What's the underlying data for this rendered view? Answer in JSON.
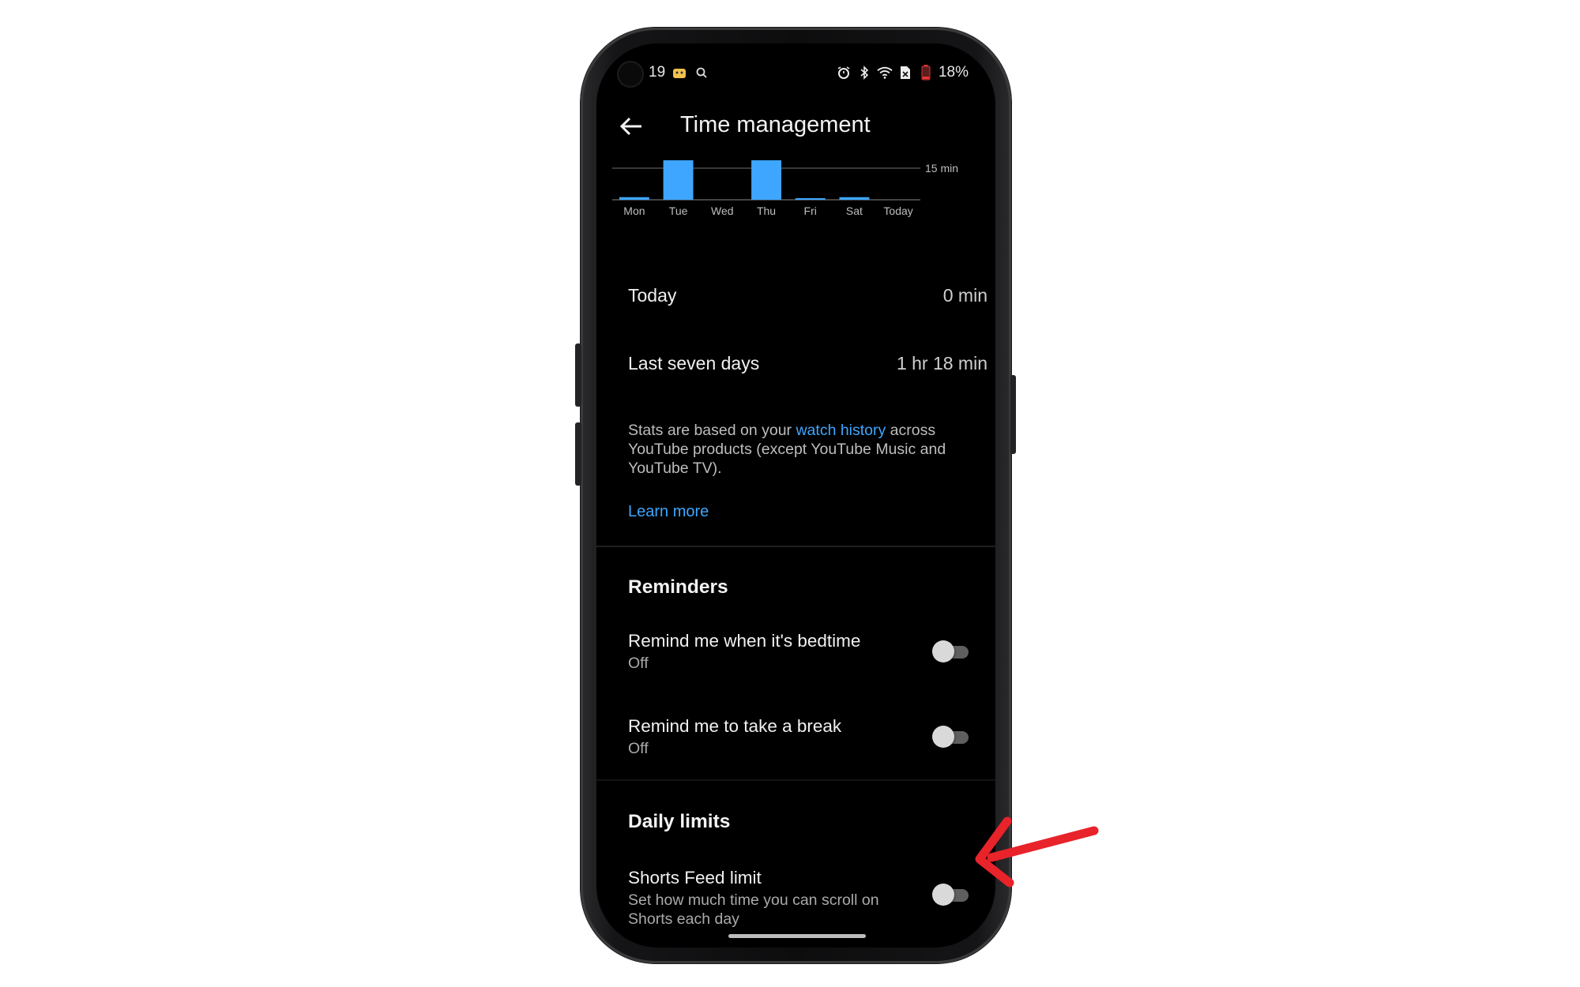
{
  "status_bar": {
    "time_partial": "19",
    "battery": "18%"
  },
  "header": {
    "title": "Time management"
  },
  "chart_data": {
    "type": "bar",
    "categories": [
      "Mon",
      "Tue",
      "Wed",
      "Thu",
      "Fri",
      "Sat",
      "Today"
    ],
    "values": [
      1,
      15,
      0,
      15,
      0.1,
      1,
      0
    ],
    "reference_label": "15 min",
    "reference_value": 15,
    "ylim": [
      0,
      15
    ],
    "color": "#3ea6ff"
  },
  "stats": {
    "today_label": "Today",
    "today_value": "0 min",
    "week_label": "Last seven days",
    "week_value": "1 hr 18 min"
  },
  "info": {
    "text_before": "Stats are based on your ",
    "link_text": "watch history",
    "text_after": " across YouTube products (except YouTube Music and YouTube TV).",
    "learn_more": "Learn more"
  },
  "reminders": {
    "heading": "Reminders",
    "bedtime_title": "Remind me when it's bedtime",
    "bedtime_status": "Off",
    "break_title": "Remind me to take a break",
    "break_status": "Off"
  },
  "daily_limits": {
    "heading": "Daily limits",
    "shorts_title": "Shorts Feed limit",
    "shorts_desc": "Set how much time you can scroll on Shorts each day"
  },
  "colors": {
    "accent": "#3ea6ff",
    "annotation_arrow": "#e8232a"
  }
}
